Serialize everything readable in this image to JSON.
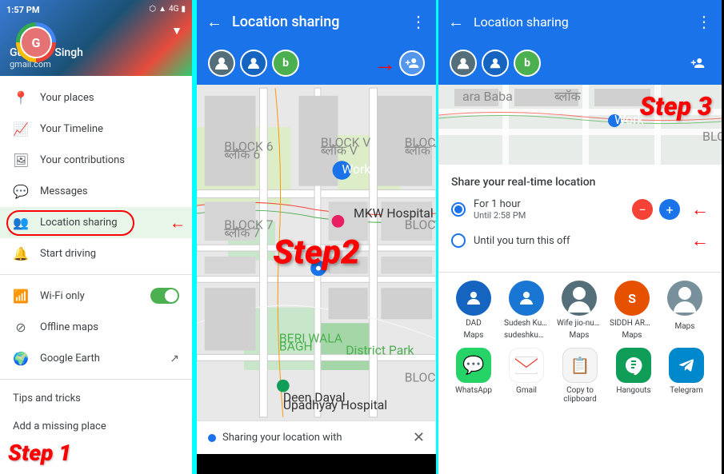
{
  "panel1": {
    "time": "1:57 PM",
    "status_icons": "▲ 4G ■",
    "user_name": "Gurdeep Singh",
    "user_email": "gmail.com",
    "menu_items": [
      {
        "label": "Your places",
        "icon": "📍"
      },
      {
        "label": "Your Timeline",
        "icon": "📈"
      },
      {
        "label": "Your contributions",
        "icon": "🖼"
      },
      {
        "label": "Messages",
        "icon": "💬"
      },
      {
        "label": "Location sharing",
        "icon": "👥"
      },
      {
        "label": "Start driving",
        "icon": "🔔"
      },
      {
        "label": "Wi-Fi only",
        "icon": "📶",
        "has_toggle": true
      },
      {
        "label": "Offline maps",
        "icon": "⊘"
      },
      {
        "label": "Google Earth",
        "icon": "🌍"
      }
    ],
    "footer_items": [
      {
        "label": "Tips and tricks"
      },
      {
        "label": "Add a missing place"
      }
    ],
    "step_label": "Step 1"
  },
  "panel2": {
    "title": "Location sharing",
    "sharing_text": "Sharing your location with",
    "step_label": "Step",
    "step_number": "2",
    "add_person_tooltip": "Add person"
  },
  "panel3": {
    "title": "Location sharing",
    "step_label": "Step 3",
    "share_section_title": "Share your real-time location",
    "option1_main": "For 1 hour",
    "option1_sub": "Until 2:58 PM",
    "option2_main": "Until you turn this off",
    "contacts": [
      {
        "name": "DAD",
        "sub": "Maps",
        "color": "#1565c0"
      },
      {
        "name": "Sudesh Kumar Jo...",
        "sub": "sudeshkum...",
        "color": "#1976d2"
      },
      {
        "name": "Wife jio-number",
        "sub": "Maps",
        "color": "#546e7a"
      },
      {
        "name": "SIDDH ARATH SI...",
        "sub": "Maps",
        "color": "#e65100"
      },
      {
        "name": "",
        "sub": "Maps",
        "color": "#78909c"
      }
    ],
    "apps": [
      {
        "name": "WhatsApp",
        "icon": "💬",
        "color": "#25d366"
      },
      {
        "name": "Gmail",
        "icon": "✉",
        "color": "#ea4335"
      },
      {
        "name": "Copy to clipboard",
        "icon": "📋",
        "color": "#5f6368"
      },
      {
        "name": "Hangouts",
        "icon": "💬",
        "color": "#0f9d58"
      },
      {
        "name": "Telegram",
        "icon": "✈",
        "color": "#0088cc"
      }
    ]
  }
}
